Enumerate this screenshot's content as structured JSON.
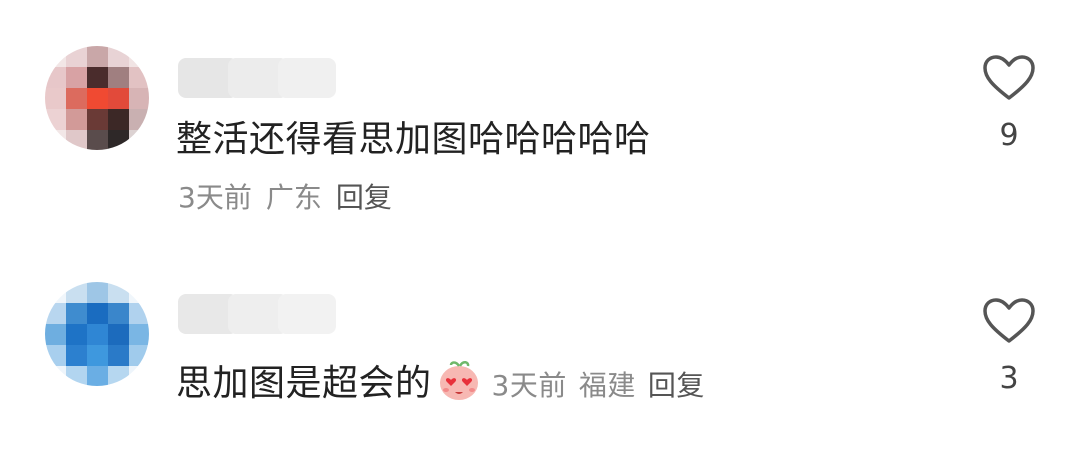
{
  "comments": [
    {
      "text": "整活还得看思加图哈哈哈哈哈",
      "time": "3天前",
      "location": "广东",
      "reply_label": "回复",
      "likes": "9",
      "avatar_icon": "blurred-avatar",
      "emoji": null
    },
    {
      "text": "思加图是超会的",
      "time": "3天前",
      "location": "福建",
      "reply_label": "回复",
      "likes": "3",
      "avatar_icon": "blurred-avatar",
      "emoji": "heart-eyes-emoji"
    }
  ],
  "colors": {
    "text": "#222222",
    "meta": "#8a8a8a",
    "icon": "#555555"
  },
  "icons": {
    "like": "heart-outline-icon"
  }
}
